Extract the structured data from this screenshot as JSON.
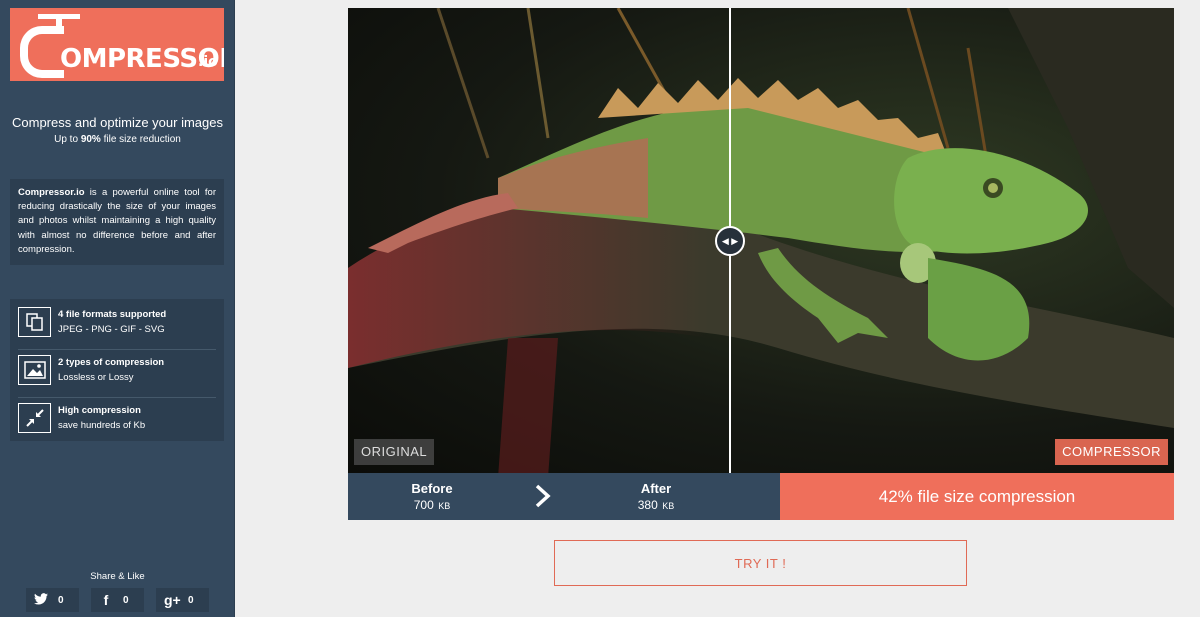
{
  "brand": {
    "name": "OMPRESSOR",
    "tld": ".io"
  },
  "sidebar": {
    "tagline": "Compress and optimize your images",
    "subtag_prefix": "Up to ",
    "subtag_highlight": "90%",
    "subtag_suffix": " file size reduction",
    "description_brand": "Compressor.io",
    "description_text": " is a powerful online tool for reducing drastically the size of your images and photos whilst maintaining a high quality with almost no difference before and after compression.",
    "features": [
      {
        "icon": "file-formats-icon",
        "title": "4 file formats supported",
        "subtitle": "JPEG - PNG - GIF - SVG"
      },
      {
        "icon": "image-icon",
        "title": "2 types of compression",
        "subtitle": "Lossless or Lossy"
      },
      {
        "icon": "compress-arrows-icon",
        "title": "High compression",
        "subtitle": "save hundreds of Kb"
      }
    ],
    "share_label": "Share & Like",
    "share_buttons": [
      {
        "icon": "twitter-icon",
        "glyph": "🐦",
        "count": "0"
      },
      {
        "icon": "facebook-icon",
        "glyph": "f",
        "count": "0"
      },
      {
        "icon": "google-plus-icon",
        "glyph": "g+",
        "count": "0"
      }
    ]
  },
  "comparison": {
    "label_original": "ORIGINAL",
    "label_compressed": "COMPRESSOR",
    "handle_glyph": "◀ ▶"
  },
  "stats": {
    "before_title": "Before",
    "before_value": "700",
    "before_unit": "KB",
    "after_title": "After",
    "after_value": "380",
    "after_unit": "KB",
    "ratio_text": "42% file size compression"
  },
  "cta": {
    "label": "TRY IT !"
  },
  "colors": {
    "sidebar": "#34495e",
    "panel": "#2c3e50",
    "accent": "#ef6f5b",
    "background": "#eeeeee"
  }
}
